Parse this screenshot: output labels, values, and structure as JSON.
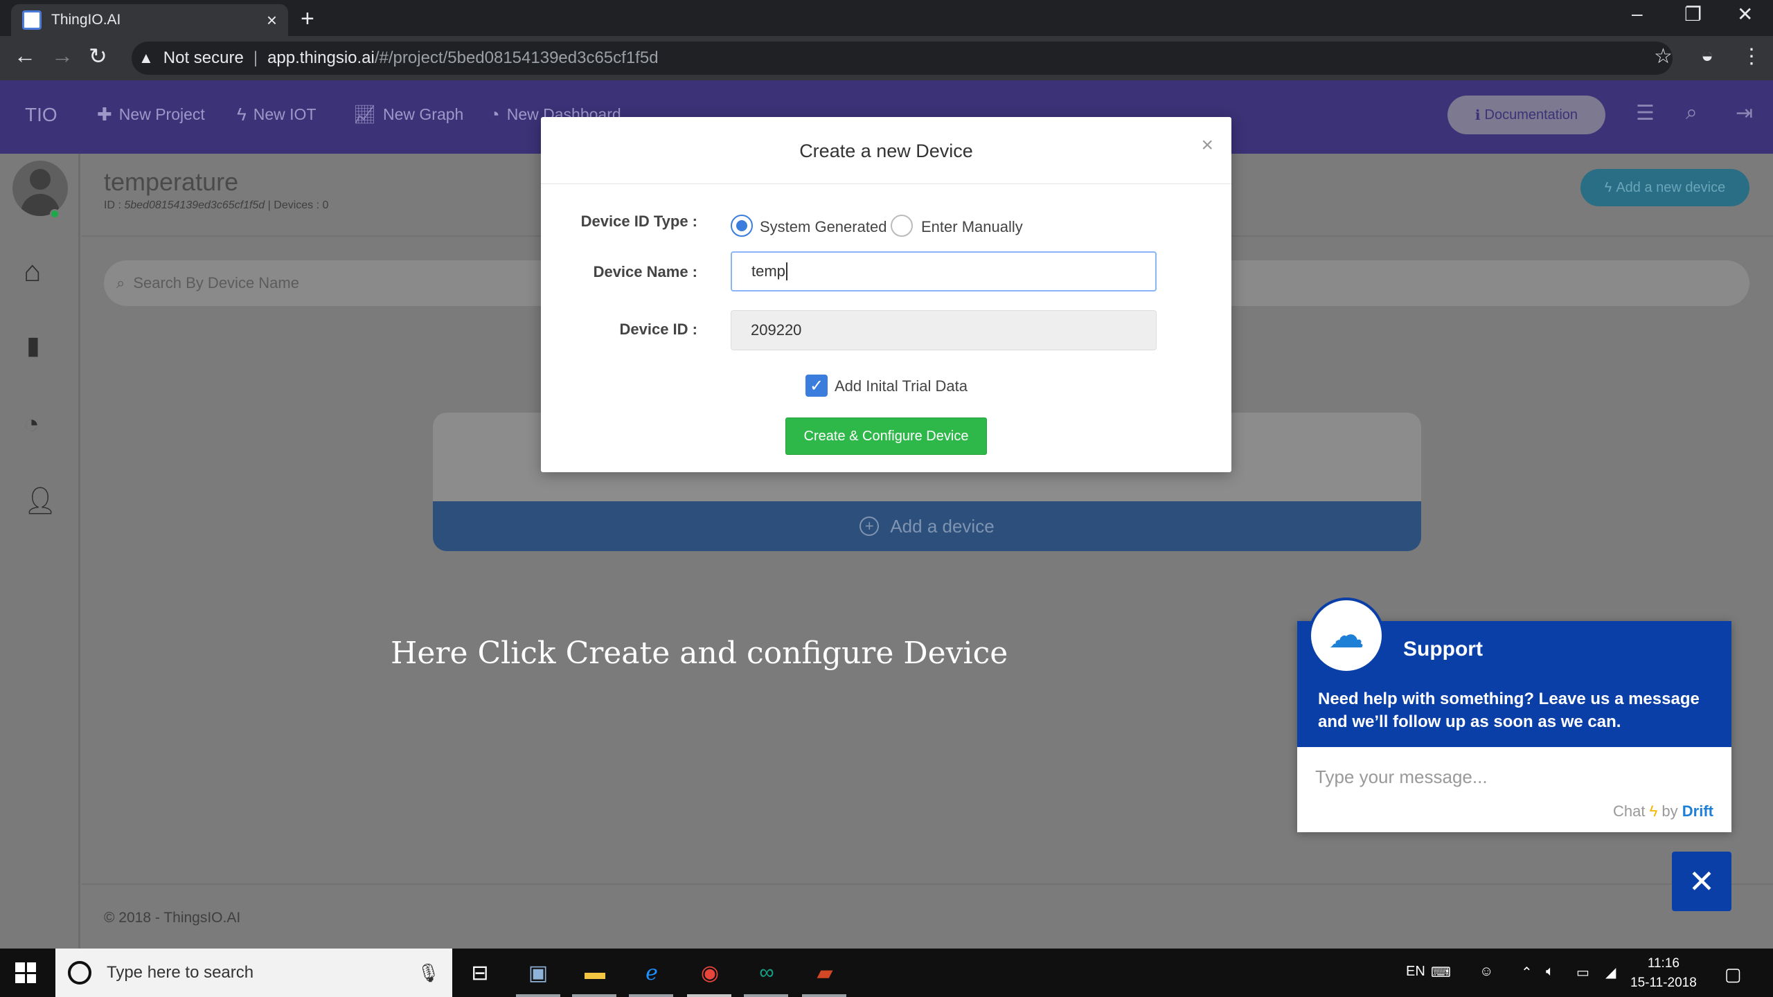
{
  "browser": {
    "tab_title": "ThingIO.AI",
    "tab_close": "×",
    "new_tab": "+",
    "security_label": "Not secure",
    "url_host": "app.thingsio.ai",
    "url_path": "/#/project/5bed08154139ed3c65cf1f5d"
  },
  "app_nav": {
    "brand": "TIO",
    "links": [
      "New Project",
      "New IOT",
      "New Graph",
      "New Dashboard"
    ],
    "documentation_label": "Documentation"
  },
  "project": {
    "title": "temperature",
    "id_label": "ID :",
    "id_value": "5bed08154139ed3c65cf1f5d",
    "devices_label": "Devices : 0",
    "add_new_device_label": "Add a new device",
    "search_placeholder": "Search By Device Name",
    "add_device_label": "Add a device"
  },
  "modal": {
    "title": "Create a new Device",
    "close": "×",
    "id_type_label": "Device ID Type :",
    "options": [
      "System Generated",
      "Enter Manually"
    ],
    "selected_option": "System Generated",
    "device_name_label": "Device Name :",
    "device_name_value": "temp",
    "device_id_label": "Device ID :",
    "device_id_value": "209220",
    "trial_data_label": "Add Inital Trial Data",
    "trial_data_checked": true,
    "create_button_label": "Create & Configure Device"
  },
  "instruction_text": "Here Click Create and configure Device",
  "footer_text": "© 2018 - ThingsIO.AI",
  "support": {
    "title": "Support",
    "message": "Need help with something? Leave us a message and we’ll follow up as soon as we can.",
    "input_placeholder": "Type your message...",
    "credit_chat": "Chat",
    "credit_by": "by",
    "credit_brand": "Drift"
  },
  "taskbar": {
    "search_placeholder": "Type here to search",
    "language": "EN",
    "time": "11:16",
    "date": "15-11-2018"
  },
  "colors": {
    "app_nav_bg": "#3b3277",
    "create_button": "#2eb84a",
    "radio_accent": "#3b7ddd",
    "support_bg": "#0b3fa8"
  }
}
